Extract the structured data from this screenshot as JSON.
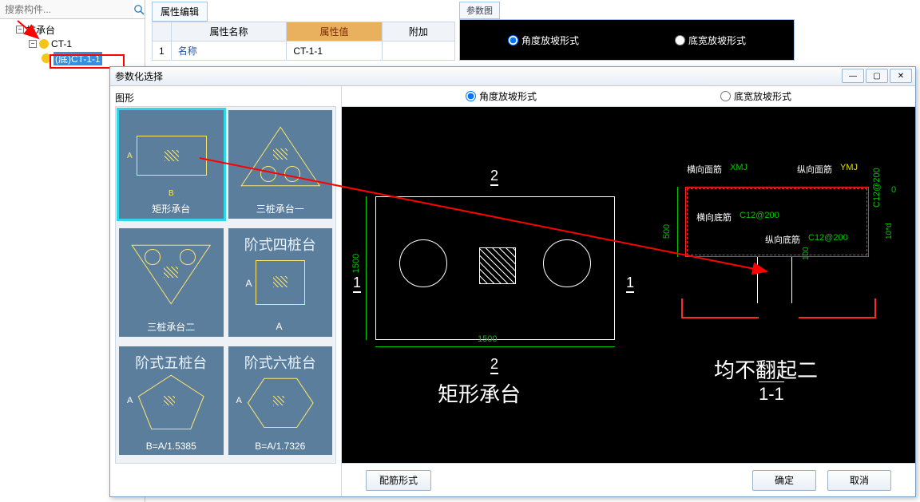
{
  "search": {
    "placeholder": "搜索构件..."
  },
  "tree": {
    "root": "桩承台",
    "child1": "CT-1",
    "child2": "(底)CT-1-1"
  },
  "propEditor": {
    "tab": "属性编辑",
    "headers": {
      "name": "属性名称",
      "value": "属性值",
      "extra": "附加"
    },
    "row1": {
      "idx": "1",
      "name": "名称",
      "value": "CT-1-1"
    }
  },
  "paramView": {
    "tab": "参数图",
    "opt1": "角度放坡形式",
    "opt2": "底宽放坡形式"
  },
  "dialog": {
    "title": "参数化选择",
    "shapeHeader": "图形",
    "shapes": {
      "s1": "矩形承台",
      "s2": "三桩承台一",
      "s3": "三桩承台二",
      "s4": "阶式四桩台",
      "s4_A": "A",
      "s5": "阶式五桩台",
      "s5_sub": "B=A/1.5385",
      "s6": "阶式六桩台",
      "s6_sub": "B=A/1.7326"
    },
    "radios": {
      "opt1": "角度放坡形式",
      "opt2": "底宽放坡形式"
    },
    "cad": {
      "dim_w": "1500",
      "dim_h": "1500",
      "dim_500": "500",
      "mark1": "1",
      "mark2": "2",
      "title_plan": "矩形承台",
      "title_sect": "均不翻起二",
      "sect_sub": "1-1",
      "heng_mian": "横向面筋",
      "heng_mian_v": "XMJ",
      "zong_mian": "纵向面筋",
      "zong_mian_v": "YMJ",
      "heng_di": "横向底筋",
      "heng_di_v": "C12@200",
      "zong_di": "纵向底筋",
      "zong_di_v": "C12@200",
      "side_v": "C12@200",
      "d0": "0",
      "d10xd": "10*d",
      "d100": "100"
    },
    "buttons": {
      "rebar": "配筋形式",
      "ok": "确定",
      "cancel": "取消"
    }
  }
}
